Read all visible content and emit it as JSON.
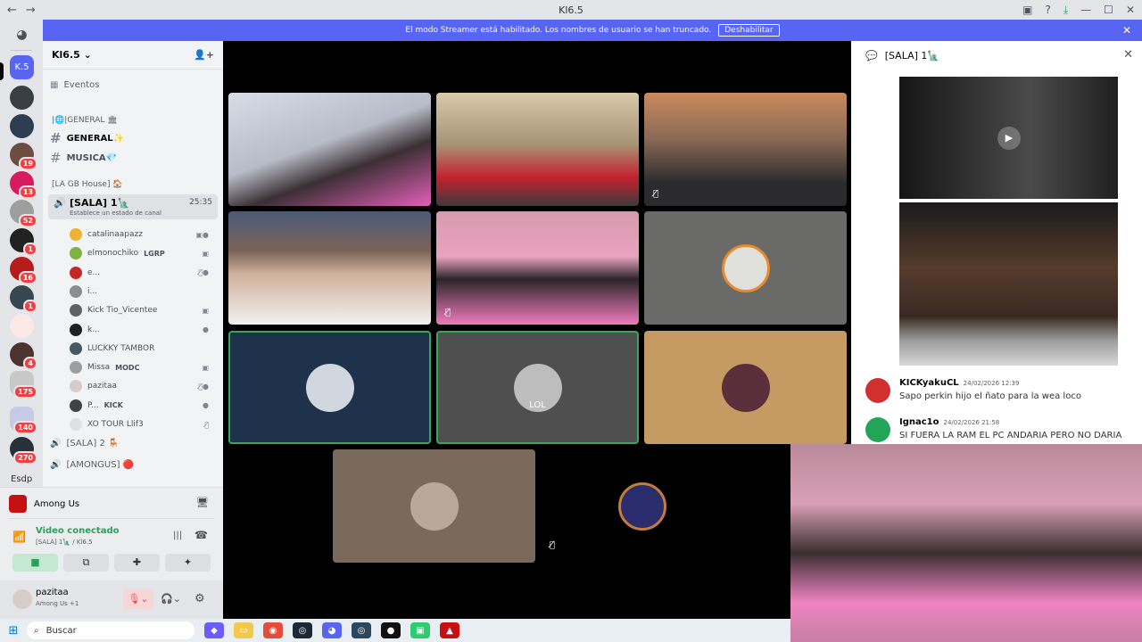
{
  "window": {
    "title": "Kl6.5",
    "back_icon": "arrow-left-icon",
    "forward_icon": "arrow-right-icon"
  },
  "banner": {
    "text": "El modo Streamer está habilitado. Los nombres de usuario se han truncado.",
    "button": "Deshabilitar"
  },
  "rail": {
    "home_icon": "discord-logo-icon",
    "top_server": "K.5",
    "badges": [
      "19",
      "13",
      "52",
      "1",
      "16",
      "1",
      "4",
      "175",
      "140",
      "270"
    ],
    "bottom_label": "Esdp"
  },
  "sidebar": {
    "guild_name": "Kl6.5",
    "events": "Eventos",
    "cat_general": "|🌐|GENERAL 🏛",
    "chan_general": "GENERAL✨",
    "chan_musica": "MUSICA💎",
    "cat_house": "[LA GB House] 🏠",
    "voice_sala1": "[SALA] 1🗽",
    "voice_timer": "25:35",
    "voice_status": "Establece un estado de canal",
    "users": [
      {
        "name": "catalinaapazz",
        "tag": ""
      },
      {
        "name": "elmonochiko",
        "tag": "LGRP"
      },
      {
        "name": "e...",
        "tag": ""
      },
      {
        "name": "i...",
        "tag": ""
      },
      {
        "name": "Kick Tio_Vicentee",
        "tag": ""
      },
      {
        "name": "k...",
        "tag": ""
      },
      {
        "name": "LUCKKY TAMBOR",
        "tag": ""
      },
      {
        "name": "Missa",
        "tag": "MODC"
      },
      {
        "name": "pazitaa",
        "tag": ""
      },
      {
        "name": "P...",
        "tag": "KICK"
      },
      {
        "name": "XO TOUR Llif3",
        "tag": ""
      }
    ],
    "voice_sala2": "[SALA] 2 🪑",
    "voice_amongus": "[AMONGUS] 🔴"
  },
  "panel": {
    "activity": "Among Us",
    "voice_status": "Video conectado",
    "voice_location": "[SALA] 1🗽 / Kl6.5",
    "user_name": "pazitaa",
    "user_status": "Among Us +1"
  },
  "chat": {
    "title": "[SALA] 1🗽",
    "messages": [
      {
        "name": "KICKyakuCL",
        "ts": "24/02/2026 12:39",
        "text": "Sapo perkin hijo el ñato para la wea loco"
      },
      {
        "name": "Ignac1o",
        "ts": "24/02/2026 21:58",
        "text": "SI FUERA LA RAM EL PC ANDARIA PERO NO DARIA"
      }
    ]
  },
  "stage": {
    "tile_label": "LOL"
  },
  "taskbar": {
    "search": "Buscar"
  },
  "colors": {
    "blurple": "#5865f2",
    "speaking": "#23a559",
    "danger": "#f23f43"
  }
}
